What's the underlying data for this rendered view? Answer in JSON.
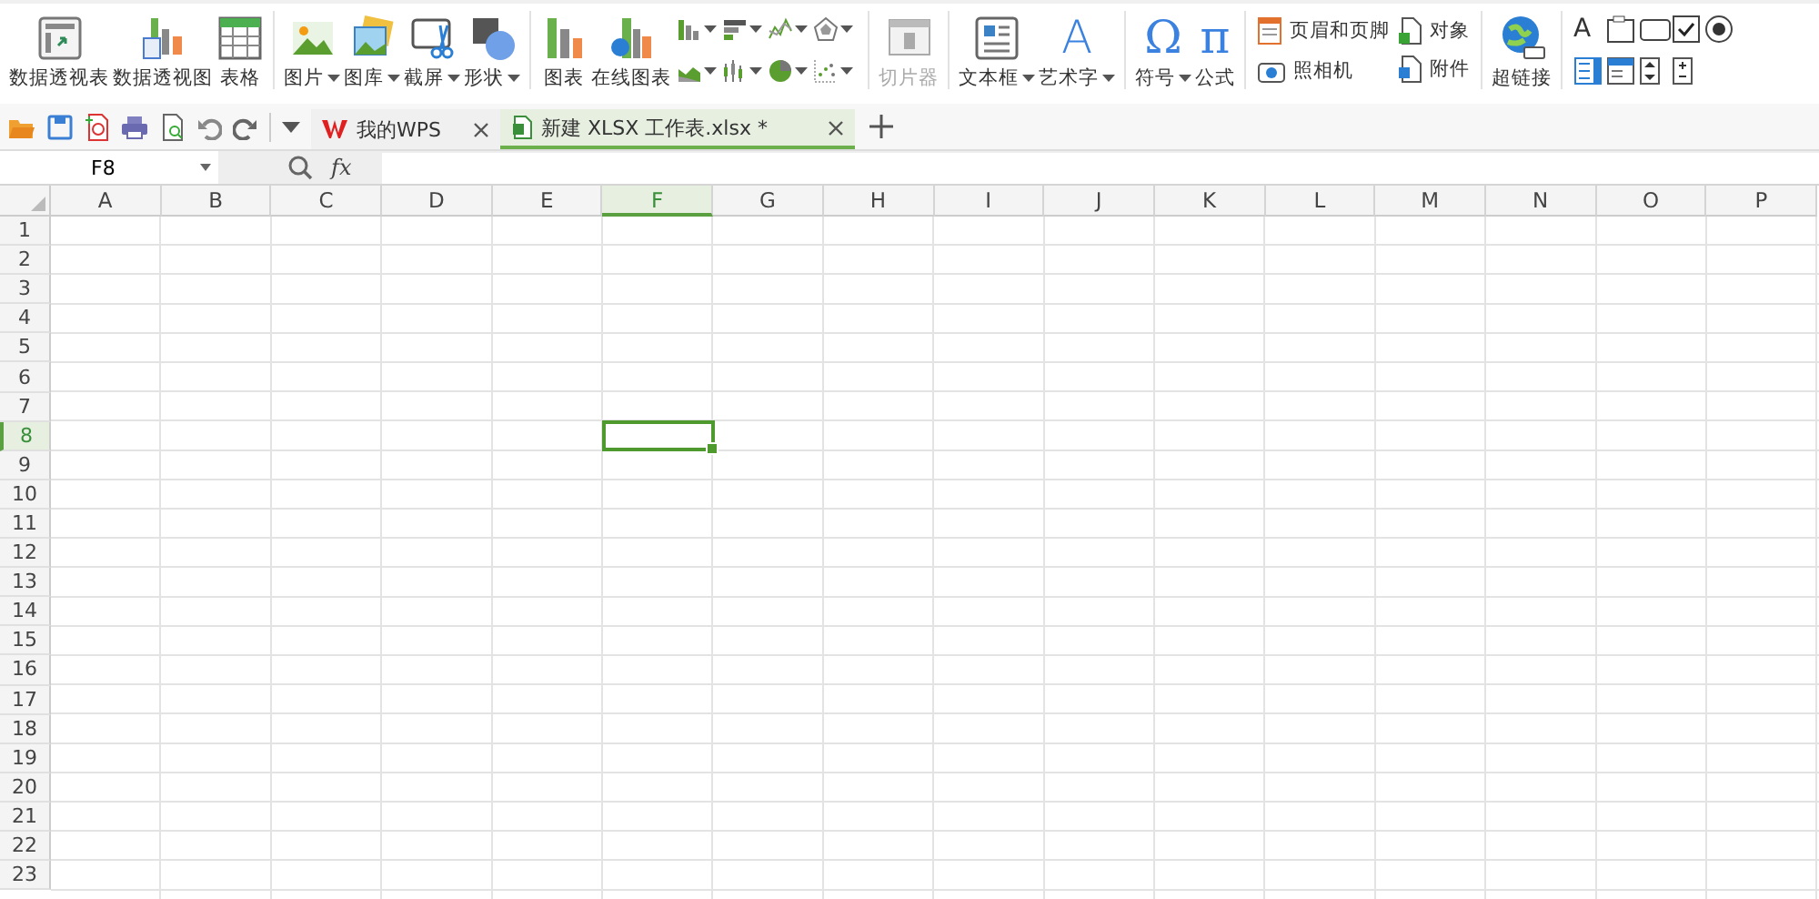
{
  "ribbon": {
    "groups": [
      {
        "items": [
          {
            "kind": "large",
            "label": "数据透视表",
            "dropdown": false,
            "disabled": false
          },
          {
            "kind": "large",
            "label": "数据透视图",
            "dropdown": false,
            "disabled": false
          },
          {
            "kind": "large",
            "label": "表格",
            "dropdown": false,
            "disabled": false
          }
        ]
      },
      {
        "items": [
          {
            "kind": "large",
            "label": "图片",
            "dropdown": true,
            "disabled": false
          },
          {
            "kind": "large",
            "label": "图库",
            "dropdown": true,
            "disabled": false
          },
          {
            "kind": "large",
            "label": "截屏",
            "dropdown": true,
            "disabled": false
          },
          {
            "kind": "large",
            "label": "形状",
            "dropdown": true,
            "disabled": false
          }
        ]
      },
      {
        "items": [
          {
            "kind": "large",
            "label": "图表",
            "dropdown": false,
            "disabled": false
          },
          {
            "kind": "large",
            "label": "在线图表",
            "dropdown": false,
            "disabled": false
          },
          {
            "kind": "chart-icons"
          }
        ]
      },
      {
        "items": [
          {
            "kind": "large",
            "label": "切片器",
            "dropdown": false,
            "disabled": true
          }
        ]
      },
      {
        "items": [
          {
            "kind": "large",
            "label": "文本框",
            "dropdown": true,
            "disabled": false
          },
          {
            "kind": "large",
            "label": "艺术字",
            "glyph": "A",
            "dropdown": true,
            "disabled": false
          }
        ]
      },
      {
        "items": [
          {
            "kind": "large",
            "label": "符号",
            "glyph": "Ω",
            "dropdown": true,
            "disabled": false
          },
          {
            "kind": "large",
            "label": "公式",
            "glyph": "π",
            "dropdown": false,
            "disabled": false
          }
        ]
      },
      {
        "items": [
          {
            "kind": "small-stack",
            "entries": [
              {
                "label": "页眉和页脚"
              },
              {
                "label": "照相机"
              }
            ]
          },
          {
            "kind": "small-stack",
            "entries": [
              {
                "label": "对象"
              },
              {
                "label": "附件"
              }
            ]
          }
        ]
      },
      {
        "items": [
          {
            "kind": "large",
            "label": "超链接",
            "dropdown": false,
            "disabled": false
          }
        ]
      },
      {
        "items": [
          {
            "kind": "control-icons",
            "glyph": "A"
          }
        ]
      }
    ]
  },
  "tabs": [
    {
      "label": "我的WPS",
      "selected": false
    },
    {
      "label": "新建 XLSX 工作表.xlsx *",
      "selected": true
    }
  ],
  "formula_bar": {
    "name_box": "F8",
    "fx": "fx"
  },
  "columns": [
    {
      "label": "A",
      "selected": false
    },
    {
      "label": "B",
      "selected": false
    },
    {
      "label": "C",
      "selected": false
    },
    {
      "label": "D",
      "selected": false
    },
    {
      "label": "E",
      "selected": false
    },
    {
      "label": "F",
      "selected": true
    },
    {
      "label": "G",
      "selected": false
    },
    {
      "label": "H",
      "selected": false
    },
    {
      "label": "I",
      "selected": false
    },
    {
      "label": "J",
      "selected": false
    },
    {
      "label": "K",
      "selected": false
    },
    {
      "label": "L",
      "selected": false
    },
    {
      "label": "M",
      "selected": false
    },
    {
      "label": "N",
      "selected": false
    },
    {
      "label": "O",
      "selected": false
    },
    {
      "label": "P",
      "selected": false
    }
  ],
  "rows": [
    {
      "label": "1",
      "selected": false
    },
    {
      "label": "2",
      "selected": false
    },
    {
      "label": "3",
      "selected": false
    },
    {
      "label": "4",
      "selected": false
    },
    {
      "label": "5",
      "selected": false
    },
    {
      "label": "6",
      "selected": false
    },
    {
      "label": "7",
      "selected": false
    },
    {
      "label": "8",
      "selected": true
    },
    {
      "label": "9",
      "selected": false
    },
    {
      "label": "10",
      "selected": false
    },
    {
      "label": "11",
      "selected": false
    },
    {
      "label": "12",
      "selected": false
    },
    {
      "label": "13",
      "selected": false
    },
    {
      "label": "14",
      "selected": false
    },
    {
      "label": "15",
      "selected": false
    },
    {
      "label": "16",
      "selected": false
    },
    {
      "label": "17",
      "selected": false
    },
    {
      "label": "18",
      "selected": false
    },
    {
      "label": "19",
      "selected": false
    },
    {
      "label": "20",
      "selected": false
    },
    {
      "label": "21",
      "selected": false
    },
    {
      "label": "22",
      "selected": false
    },
    {
      "label": "23",
      "selected": false
    }
  ]
}
